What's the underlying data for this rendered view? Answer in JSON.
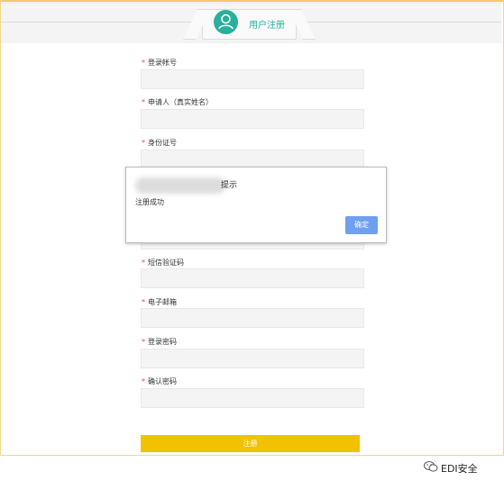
{
  "header": {
    "title": "用户注册",
    "icon": "user-avatar-icon",
    "accent": "#2aaf9c"
  },
  "form": {
    "fields": [
      {
        "label": "登录帐号",
        "required": true
      },
      {
        "label": "申请人（真实姓名）",
        "required": true
      },
      {
        "label": "身份证号",
        "required": true
      },
      {
        "label": "短信验证码",
        "required": true
      },
      {
        "label": "电子邮箱",
        "required": true
      },
      {
        "label": "登录密码",
        "required": true
      },
      {
        "label": "确认密码",
        "required": true
      }
    ],
    "submit_label": "注册",
    "submit_color": "#f2c200"
  },
  "dialog": {
    "title": "提示",
    "message": "注册成功",
    "ok_label": "确定",
    "ok_color": "#6ea0ef"
  },
  "watermark": {
    "text": "EDI安全"
  }
}
